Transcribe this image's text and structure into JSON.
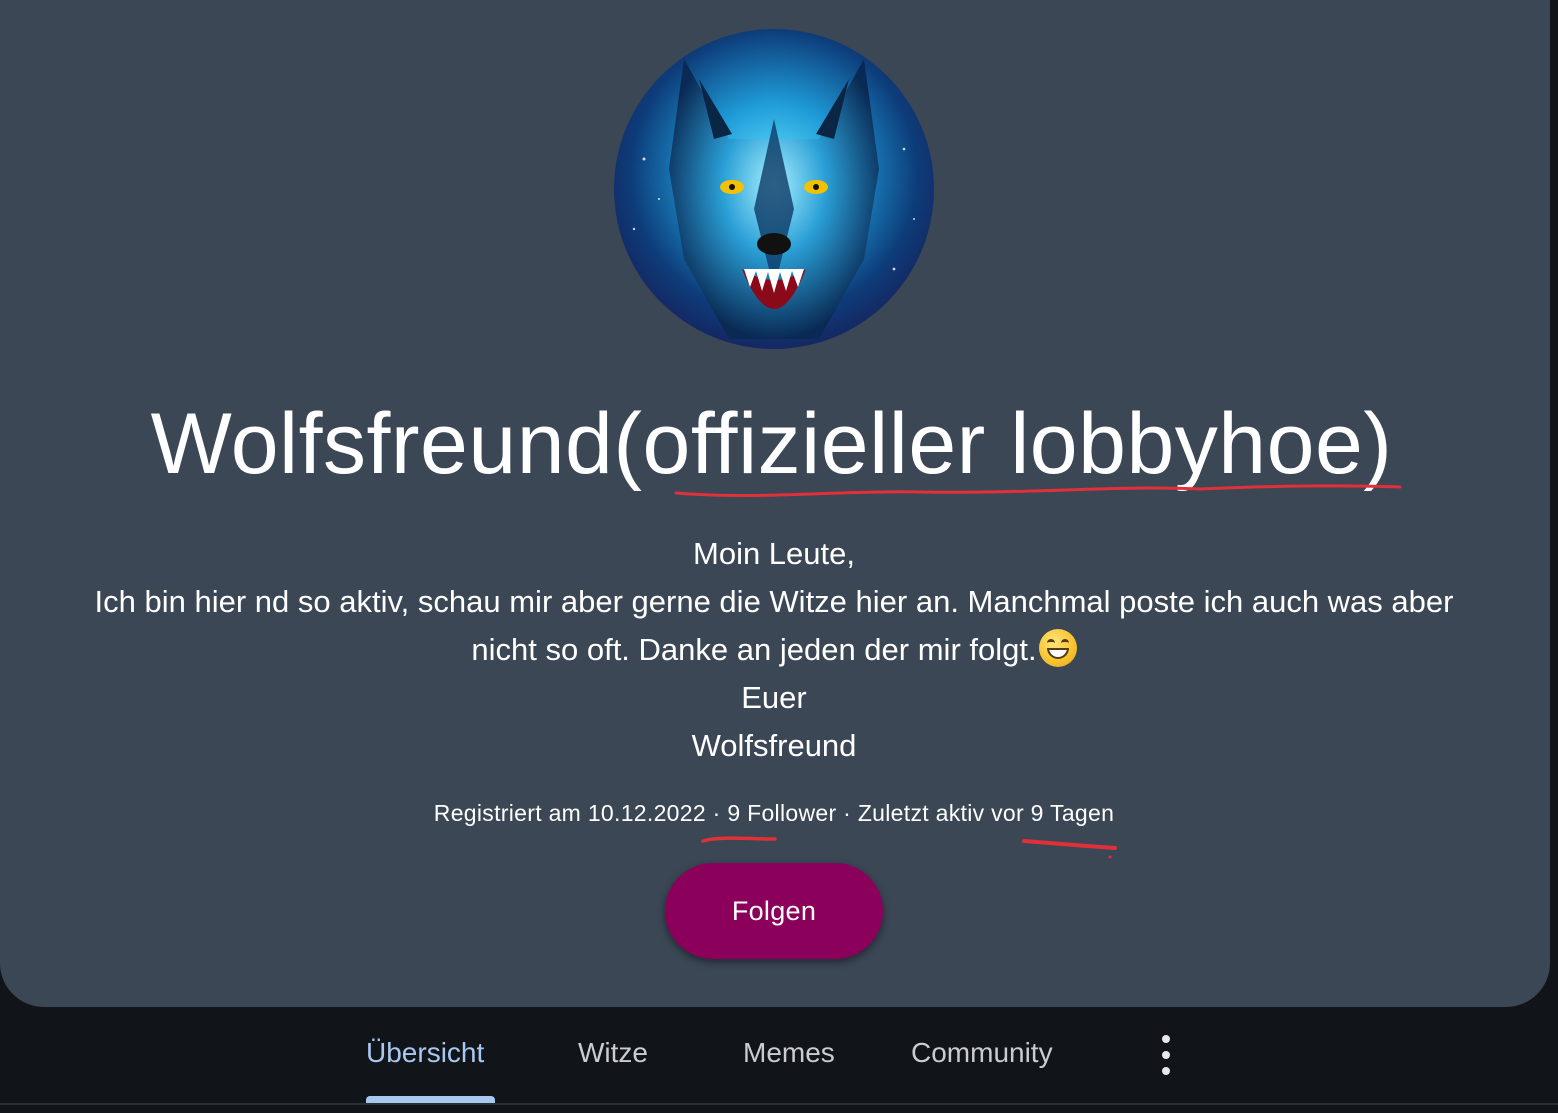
{
  "profile": {
    "name": "Wolfsfreund(offizieller lobbyhoe)",
    "bio_lines": [
      "Moin Leute,",
      "Ich bin hier nd so aktiv, schau mir aber gerne die Witze hier an. Manchmal poste ich auch was aber",
      "nicht so oft. Danke an jeden der mir folgt.",
      "Euer",
      "Wolfsfreund"
    ],
    "meta": {
      "registered": "Registriert am 10.12.2022",
      "separator": "·",
      "followers": "9 Follower",
      "last_active": "Zuletzt aktiv vor 9 Tagen"
    },
    "follow_label": "Folgen"
  },
  "tabs": [
    {
      "label": "Übersicht",
      "active": true
    },
    {
      "label": "Witze",
      "active": false
    },
    {
      "label": "Memes",
      "active": false
    },
    {
      "label": "Community",
      "active": false
    }
  ],
  "colors": {
    "card_bg": "#3b4755",
    "page_bg": "#111418",
    "follow_button": "#8b005a",
    "active_tab": "#a9c8f0",
    "annotation_red": "#e0303a"
  },
  "icons": {
    "more": "more-vert-icon",
    "emoji": "grinning-face-emoji-icon"
  }
}
